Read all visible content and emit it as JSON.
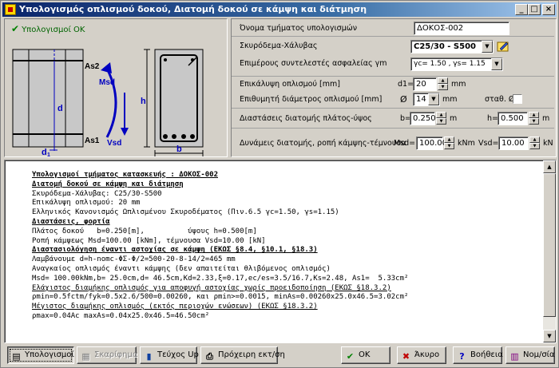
{
  "window": {
    "title": "Υπολογισμός οπλισμού δοκού, Διατομή δοκού σε κάμψη και διάτμηση",
    "minimize": "_",
    "maximize": "□",
    "close": "×"
  },
  "status": {
    "text": "Υπολογισμοί ΟΚ",
    "icon": "check-icon"
  },
  "diagram": {
    "labels": {
      "as2": "As2",
      "as1": "As1",
      "msd": "Msd",
      "vsd": "Vsd",
      "d": "d",
      "d1": "d",
      "d1_sub": "1",
      "h": "h",
      "b": "b"
    }
  },
  "form": {
    "name_label": "Όνομα τμήματος υπολογισμών",
    "name_value": "ΔΟΚΟΣ-002",
    "materials_label": "Σκυρόδεμα-Χάλυβας",
    "materials_value": "C25/30 - S500",
    "safety_label": "Επιμέρους συντελεστές ασφαλείας γm",
    "safety_value": "γc= 1.50 , γs= 1.15",
    "cover_label": "Επικάλυψη οπλισμού [mm]",
    "cover_prefix": "d1=",
    "cover_value": "20",
    "cover_unit": "mm",
    "diameter_label": "Επιθυμητή διάμετρος οπλισμού [mm]",
    "diameter_prefix": "Ø",
    "diameter_value": "14",
    "diameter_unit": "mm",
    "const_label": "σταθ. Ø",
    "dims_label": "Διαστάσεις διατομής πλάτος-ύψος",
    "b_prefix": "b=",
    "b_value": "0.250",
    "b_unit": "m",
    "h_prefix": "h=",
    "h_value": "0.500",
    "h_unit": "m",
    "forces_label": "Δυνάμεις διατομής, ροπή κάμψης-τέμνουσα",
    "msd_prefix": "Msd=",
    "msd_value": "100.00",
    "msd_unit": "kNm",
    "vsd_prefix": "Vsd=",
    "vsd_value": "10.00",
    "vsd_unit": "kN"
  },
  "report": {
    "lines": [
      {
        "style": "hd",
        "text": "Υπολογισμοί τμήματος κατασκευής : ΔΟΚΟΣ-002"
      },
      {
        "style": "hd",
        "text": "Διατομή δοκού σε κάμψη και διάτμηση"
      },
      {
        "style": "",
        "text": "Σκυρόδεμα-Χάλυβας: C25/30-S500"
      },
      {
        "style": "",
        "text": "Επικάλυψη οπλισμού: 20 mm"
      },
      {
        "style": "",
        "text": "Ελληνικός Κανονισμός Ωπλισμένου Σκυροδέματος (Πιν.6.5 γc=1.50, γs=1.15)"
      },
      {
        "style": "hd",
        "text": "Διαστάσεις, φορτία"
      },
      {
        "style": "",
        "text": "Πλάτος δοκού   b=0.250[m],          ύψους h=0.500[m]"
      },
      {
        "style": "",
        "text": "Ροπή κάμψεως Msd=100.00 [kNm], τέμνουσα Vsd=10.00 [kN]"
      },
      {
        "style": "hd",
        "text": "Διαστασιολόγηση έναντι αστοχίας σε κάμψη (ΕΚΩΣ §8.4, §10.1, §18.3)"
      },
      {
        "style": "",
        "text": "Λαμβάνουμε d=h-nomc-ΦΣ-Φ/2=500-20-8-14/2=465 mm"
      },
      {
        "style": "",
        "text": "Αναγκαίος οπλισμός έναντι κάμψης (δεν απαιτείται θλιβόμενος οπλισμός)"
      },
      {
        "style": "",
        "text": "Msd= 100.00kNm,b= 25.0cm,d= 46.5cm,Kd=2.33,ξ=0.17,ec/es=3.5/16.7,Ks=2.48, As1=  5.33cm²"
      },
      {
        "style": "sub",
        "text": "Ελάχιστος διαμήκης οπλισμός για αποφυγή αστοχίας χωρίς προειδοποίηση (ΕΚΩΣ §18.3.2)"
      },
      {
        "style": "",
        "text": "ρmin=0.5fctm/fyk=0.5x2.6/500=0.00260, και ρmin>=0.0015, minAs=0.00260x25.0x46.5=3.02cm²"
      },
      {
        "style": "sub",
        "text": "Μέγιστος διαμήκης οπλισμός (εκτός περιοχών ενώσεων) (ΕΚΩΣ §18.3.2)"
      },
      {
        "style": "",
        "text": "ρmax=0.04Ac maxAs=0.04x25.0x46.5=46.50cm²"
      }
    ]
  },
  "buttons": {
    "calc": "Υπολογισμοί",
    "sketch": "Σκαρίφημα",
    "book": "Τεύχος Up",
    "draft": "Πρόχειρη εκτ/ση",
    "ok": "ΟΚ",
    "cancel": "Άκυρο",
    "help": "Βοήθεια",
    "units": "Νομ/σία"
  },
  "colors": {
    "titlebar": "#0a246a",
    "ok_green": "#008000",
    "drawing_blue": "#0000c0"
  }
}
